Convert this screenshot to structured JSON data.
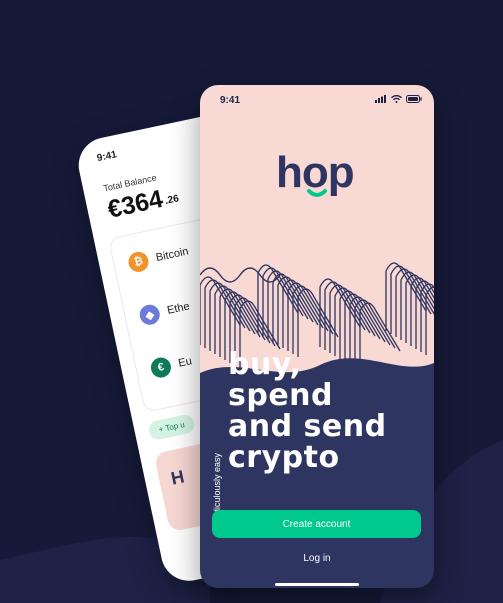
{
  "colors": {
    "background": "#161a38",
    "navy": "#2e3560",
    "pink": "#f9d9d4",
    "green": "#00c98d"
  },
  "back_phone": {
    "time": "9:41",
    "balance_label": "Total Balance",
    "balance_main": "€364",
    "balance_cents": ".26",
    "assets": [
      {
        "name": "Bitcoin",
        "icon": "bitcoin-icon",
        "symbol": "₿",
        "color": "#f0932b"
      },
      {
        "name": "Ethe",
        "icon": "ethereum-icon",
        "symbol": "◆",
        "color": "#6c7bd8"
      },
      {
        "name": "Eu",
        "icon": "euro-icon",
        "symbol": "€",
        "color": "#0f7a5a"
      }
    ],
    "top_up_label": "+ Top u",
    "card_heading": "H"
  },
  "front_phone": {
    "time": "9:41",
    "logo": "hop",
    "tagline": "ridiculously easy",
    "headline": [
      "buy,",
      "spend",
      "and send",
      "crypto"
    ],
    "create_account": "Create account",
    "log_in": "Log in"
  }
}
